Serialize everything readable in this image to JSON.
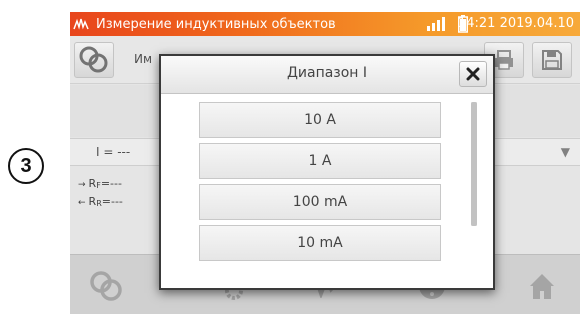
{
  "step_number": "3",
  "status_bar": {
    "title": "Измерение индуктивных объектов",
    "datetime": "14:21 2019.04.10",
    "icons": [
      "meter-logo-icon",
      "signal-icon",
      "battery-icon"
    ]
  },
  "toolbar": {
    "partial_label": "Им",
    "icons": [
      "resistance-mode-icon",
      "print-icon",
      "save-icon"
    ]
  },
  "measurement": {
    "current_value": "I = ---",
    "rf_reading": "---",
    "rr_reading": "---"
  },
  "dialog": {
    "title": "Диапазон I",
    "options": [
      "10 A",
      "1 A",
      "100 mA",
      "10 mA"
    ]
  },
  "bottom_nav": {
    "icons": [
      "resistance-icon",
      "settings-icon",
      "waveform-icon",
      "help-icon",
      "home-icon"
    ]
  },
  "colors": {
    "status_bar_start": "#e8451c",
    "status_bar_end": "#f7a93a",
    "dialog_border": "#3a3a3a",
    "background": "#f2f2f2"
  }
}
